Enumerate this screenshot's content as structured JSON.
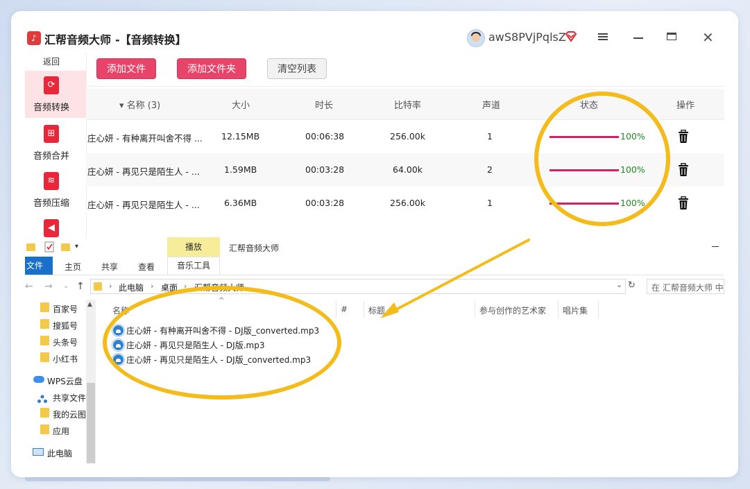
{
  "app": {
    "title": "汇帮音频大师",
    "subtitle": "-【音频转换】",
    "username": "awS8PVjPqlsZ",
    "logo_char": "♪"
  },
  "sidebar": {
    "back": "返回",
    "items": [
      {
        "label": "音频转换",
        "icon": "audio-convert-icon",
        "active": true
      },
      {
        "label": "音频合并",
        "icon": "audio-merge-icon",
        "active": false
      },
      {
        "label": "音频压缩",
        "icon": "audio-compress-icon",
        "active": false
      },
      {
        "label": "",
        "icon": "audio-speaker-icon",
        "active": false
      }
    ]
  },
  "toolbar": {
    "add_file": "添加文件",
    "add_folder": "添加文件夹",
    "clear_list": "清空列表"
  },
  "table": {
    "headers": {
      "name": "名称 (3)",
      "size": "大小",
      "duration": "时长",
      "bitrate": "比特率",
      "channels": "声道",
      "status": "状态",
      "action": "操作"
    },
    "rows": [
      {
        "name": "庄心妍 - 有种离开叫舍不得 ...",
        "size": "12.15MB",
        "duration": "00:06:38",
        "bitrate": "256.00k",
        "channels": "1",
        "progress": 1.0,
        "status": "100%"
      },
      {
        "name": "庄心妍 - 再见只是陌生人 - ...",
        "size": "1.59MB",
        "duration": "00:03:28",
        "bitrate": "64.00k",
        "channels": "2",
        "progress": 1.0,
        "status": "100%"
      },
      {
        "name": "庄心妍 - 再见只是陌生人 - ...",
        "size": "6.36MB",
        "duration": "00:03:28",
        "bitrate": "256.00k",
        "channels": "1",
        "progress": 1.0,
        "status": "100%"
      }
    ]
  },
  "explorer": {
    "title": "汇帮音频大师",
    "play_tab": "播放",
    "ribbon_tabs": {
      "file": "文件",
      "home": "主页",
      "share": "共享",
      "view": "查看",
      "music": "音乐工具"
    },
    "breadcrumb": [
      "此电脑",
      "桌面",
      "汇帮音频大师"
    ],
    "search_placeholder": "在 汇帮音频大师 中",
    "nav_items": [
      "百家号",
      "搜狐号",
      "头条号",
      "小红书",
      "WPS云盘",
      "共享文件",
      "我的云图",
      "应用",
      "此电脑"
    ],
    "columns": {
      "name": "名称",
      "number": "#",
      "title": "标题",
      "artists": "参与创作的艺术家",
      "album": "唱片集"
    },
    "files": [
      "庄心妍 - 有种离开叫舍不得 - DJ版_converted.mp3",
      "庄心妍 - 再见只是陌生人 - DJ版.mp3",
      "庄心妍 - 再见只是陌生人 - DJ版_converted.mp3"
    ]
  },
  "colors": {
    "accent_red": "#e64569",
    "progress": "#d81e63",
    "success_text": "#1f8b1f",
    "highlight": "#f3bc1a"
  }
}
